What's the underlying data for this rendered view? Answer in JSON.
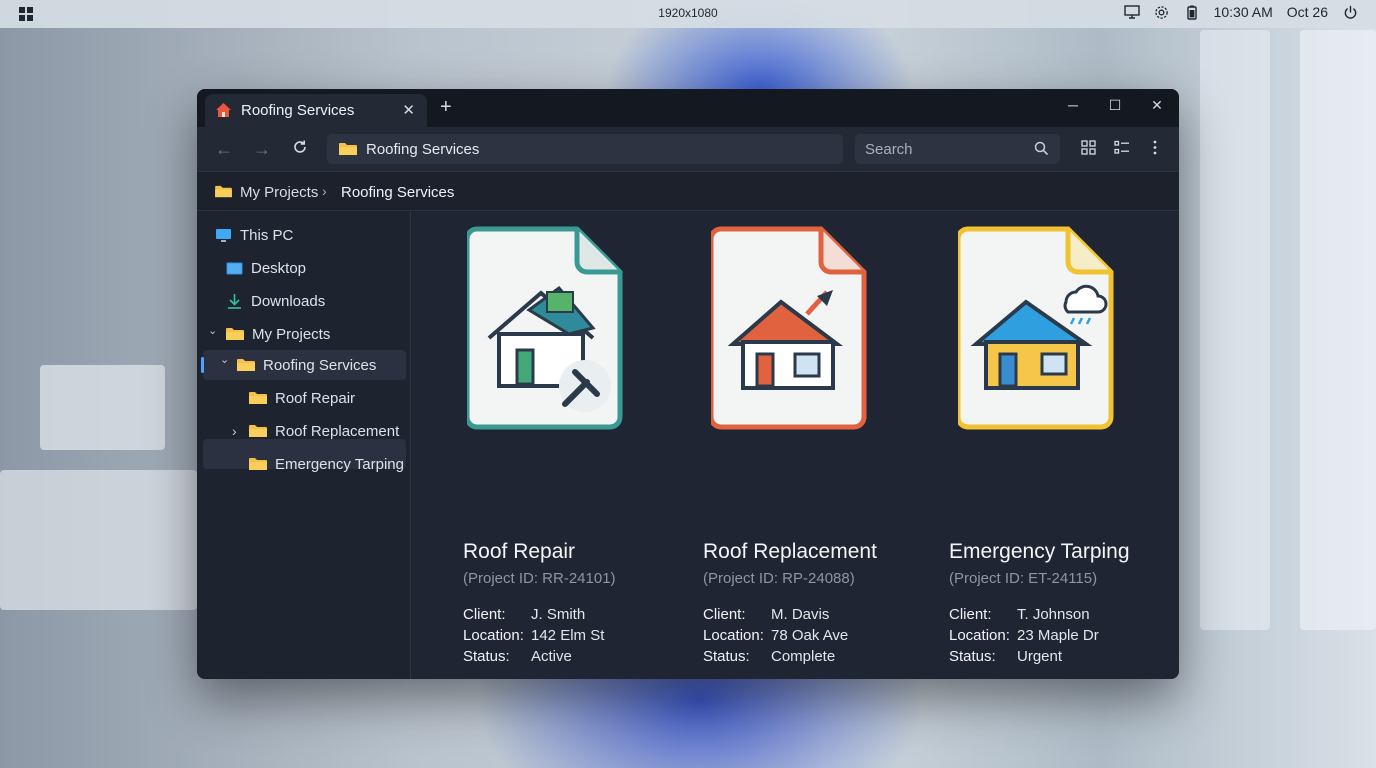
{
  "taskbar": {
    "resolution": "1920x1080",
    "time": "10:30 AM",
    "date": "Oct 26"
  },
  "window": {
    "tab_title": "Roofing Services",
    "address": "Roofing Services",
    "search_placeholder": "Search",
    "breadcrumb": [
      "My Projects",
      "Roofing Services"
    ]
  },
  "sidebar": {
    "items": [
      {
        "label": "This PC"
      },
      {
        "label": "Desktop"
      },
      {
        "label": "Downloads"
      },
      {
        "label": "My Projects"
      },
      {
        "label": "Roofing Services"
      },
      {
        "label": "Roof Repair"
      },
      {
        "label": "Roof Replacement"
      },
      {
        "label": "Emergency Tarping"
      }
    ]
  },
  "labels": {
    "client": "Client:",
    "location": "Location:",
    "status": "Status:"
  },
  "projects": [
    {
      "name": "Roof Repair",
      "project_id": "(Project ID: RR-24101)",
      "client": "J. Smith",
      "location": "142 Elm St",
      "status": "Active",
      "accent": "#3a9a93"
    },
    {
      "name": "Roof Replacement",
      "project_id": "(Project ID: RP-24088)",
      "client": "M. Davis",
      "location": "78 Oak Ave",
      "status": "Complete",
      "accent": "#e0623f"
    },
    {
      "name": "Emergency Tarping",
      "project_id": "(Project ID: ET-24115)",
      "client": "T. Johnson",
      "location": "23 Maple Dr",
      "status": "Urgent",
      "accent": "#f2c230"
    }
  ]
}
